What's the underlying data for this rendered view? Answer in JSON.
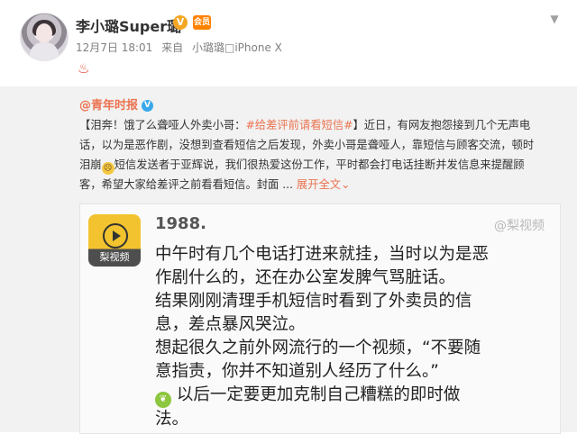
{
  "post": {
    "username": "李小璐Super璐",
    "verified_mark": "V",
    "vip_badge": "会员",
    "date": "12月7日 18:01",
    "source_prefix": "来自",
    "source": "小璐璐□iPhone X",
    "dropdown_icon": "chevron-down-icon",
    "reaction_icon": "fire-icon"
  },
  "repost": {
    "author": "@青年时报",
    "text_lines": [
      "【泪奔！饿了么聋哑人外卖小哥：",
      "#给差评前请看短信#",
      "】近日，有网友抱怨接到几个无声电",
      "话，以为是恶作剧，没想到查看短信之后发现，外卖小哥是聋哑人，靠短信与顾客交流，顿时",
      "泪崩",
      "短信发送者于亚辉说，我们很热爱这份工作，平时都会打电话挂断并发信息来提醒顾",
      "客，希望大家给差评之前看看短信。封面 ...",
      "展开全文",
      "⌄"
    ]
  },
  "screenshot": {
    "logo_label": "梨视频",
    "inner_user": "1988.",
    "watermark": "@梨视频",
    "inner_lines": [
      "中午时有几个电话打进来就挂，当时以为是恶",
      "作剧什么的，还在办公室发脾气骂脏话。",
      "结果刚刚清理手机短信时看到了外卖员的信",
      "息，差点暴风哭泣。",
      "想起很久之前外网流行的一个视频，“不要随",
      "意指责，你并不知道别人经历了什么。”",
      "以后一定要更加克制自己糟糕的即时做",
      "法。"
    ]
  },
  "colors": {
    "link": "#eb7350",
    "muted": "#808080",
    "repost_bg": "#f2f2f2"
  }
}
